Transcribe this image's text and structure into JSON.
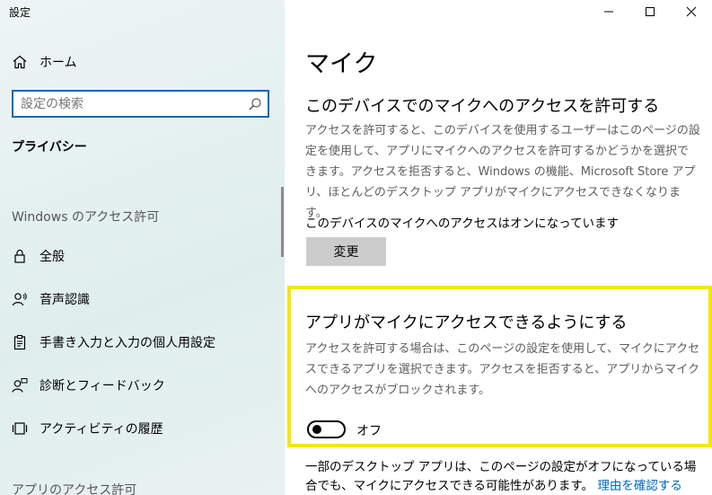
{
  "window": {
    "title": "設定",
    "minimize_icon": "minimize-icon",
    "maximize_icon": "maximize-icon",
    "close_icon": "close-icon"
  },
  "sidebar": {
    "home": {
      "label": "ホーム",
      "icon": "home-icon"
    },
    "search": {
      "placeholder": "設定の検索",
      "value": "",
      "icon": "search-icon"
    },
    "section_title": "プライバシー",
    "group1_heading": "Windows のアクセス許可",
    "items": [
      {
        "label": "全般",
        "icon": "lock-icon"
      },
      {
        "label": "音声認識",
        "icon": "speech-icon"
      },
      {
        "label": "手書き入力と入力の個人用設定",
        "icon": "clipboard-icon"
      },
      {
        "label": "診断とフィードバック",
        "icon": "feedback-icon"
      },
      {
        "label": "アクティビティの履歴",
        "icon": "activity-icon"
      }
    ],
    "group2_heading": "アプリのアクセス許可"
  },
  "main": {
    "page_title": "マイク",
    "device_section": {
      "heading": "このデバイスでのマイクへのアクセスを許可する",
      "description": "アクセスを許可すると、このデバイスを使用するユーザーはこのページの設定を使用して、アプリにマイクへのアクセスを許可するかどうかを選択できます。アクセスを拒否すると、Windows の機能、Microsoft Store アプリ、ほとんどのデスクトップ アプリがマイクにアクセスできなくなります。",
      "status": "このデバイスのマイクへのアクセスはオンになっています",
      "change_button": "変更"
    },
    "apps_section": {
      "heading": "アプリがマイクにアクセスできるようにする",
      "description": "アクセスを許可する場合は、このページの設定を使用して、マイクにアクセスできるアプリを選択できます。アクセスを拒否すると、アプリからマイクへのアクセスがブロックされます。",
      "toggle_state": "オフ",
      "toggle_on": false
    },
    "footer": {
      "text": "一部のデスクトップ アプリは、このページの設定がオフになっている場合でも、マイクにアクセスできる可能性があります。",
      "link": "理由を確認する"
    }
  },
  "colors": {
    "accent": "#0067c0",
    "highlight": "#f5e600",
    "button_bg": "#cccccc"
  }
}
